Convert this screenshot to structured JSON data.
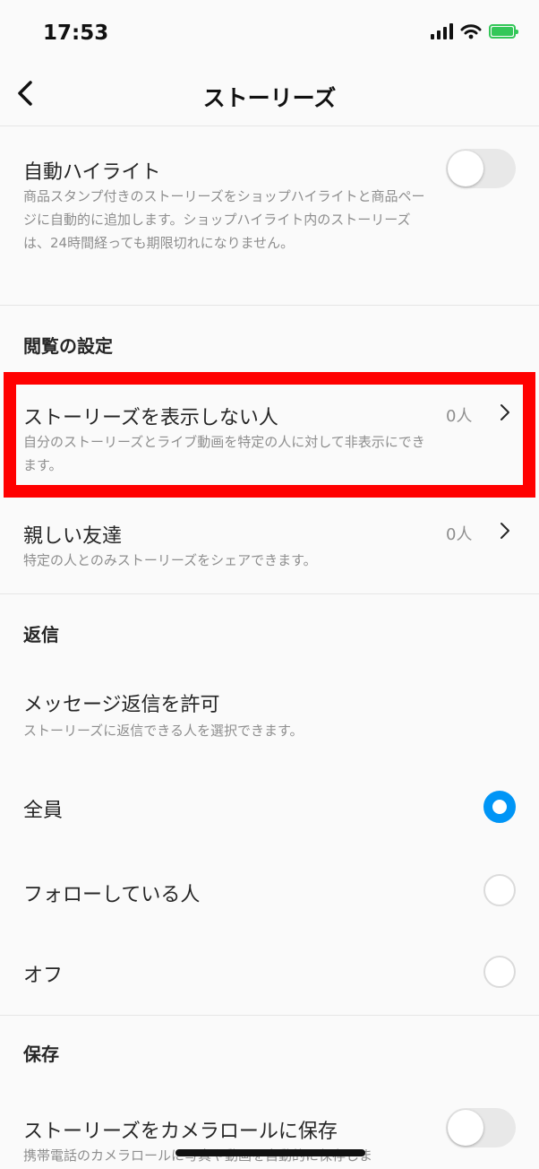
{
  "status_bar": {
    "time": "17:53"
  },
  "header": {
    "title": "ストーリーズ"
  },
  "auto_highlight": {
    "title": "自動ハイライト",
    "description": "商品スタンプ付きのストーリーズをショップハイライトと商品ページに自動的に追加します。ショップハイライト内のストーリーズは、24時間経っても期限切れになりません。",
    "enabled": false
  },
  "viewing_section": {
    "label": "閲覧の設定",
    "hide_story": {
      "title": "ストーリーズを表示しない人",
      "count": "0人",
      "description": "自分のストーリーズとライブ動画を特定の人に対して非表示にできます。"
    },
    "close_friends": {
      "title": "親しい友達",
      "count": "0人",
      "description": "特定の人とのみストーリーズをシェアできます。"
    }
  },
  "replies_section": {
    "label": "返信",
    "allow_title": "メッセージ返信を許可",
    "allow_description": "ストーリーズに返信できる人を選択できます。",
    "options": [
      {
        "label": "全員",
        "selected": true
      },
      {
        "label": "フォローしている人",
        "selected": false
      },
      {
        "label": "オフ",
        "selected": false
      }
    ]
  },
  "save_section": {
    "label": "保存",
    "camera_roll_title": "ストーリーズをカメラロールに保存",
    "camera_roll_description": "携帯電話のカメラロールに写真や動画を自動的に保存しま",
    "enabled": false
  },
  "colors": {
    "accent": "#0095f6",
    "highlight_border": "#ff0000",
    "battery": "#34c759"
  }
}
